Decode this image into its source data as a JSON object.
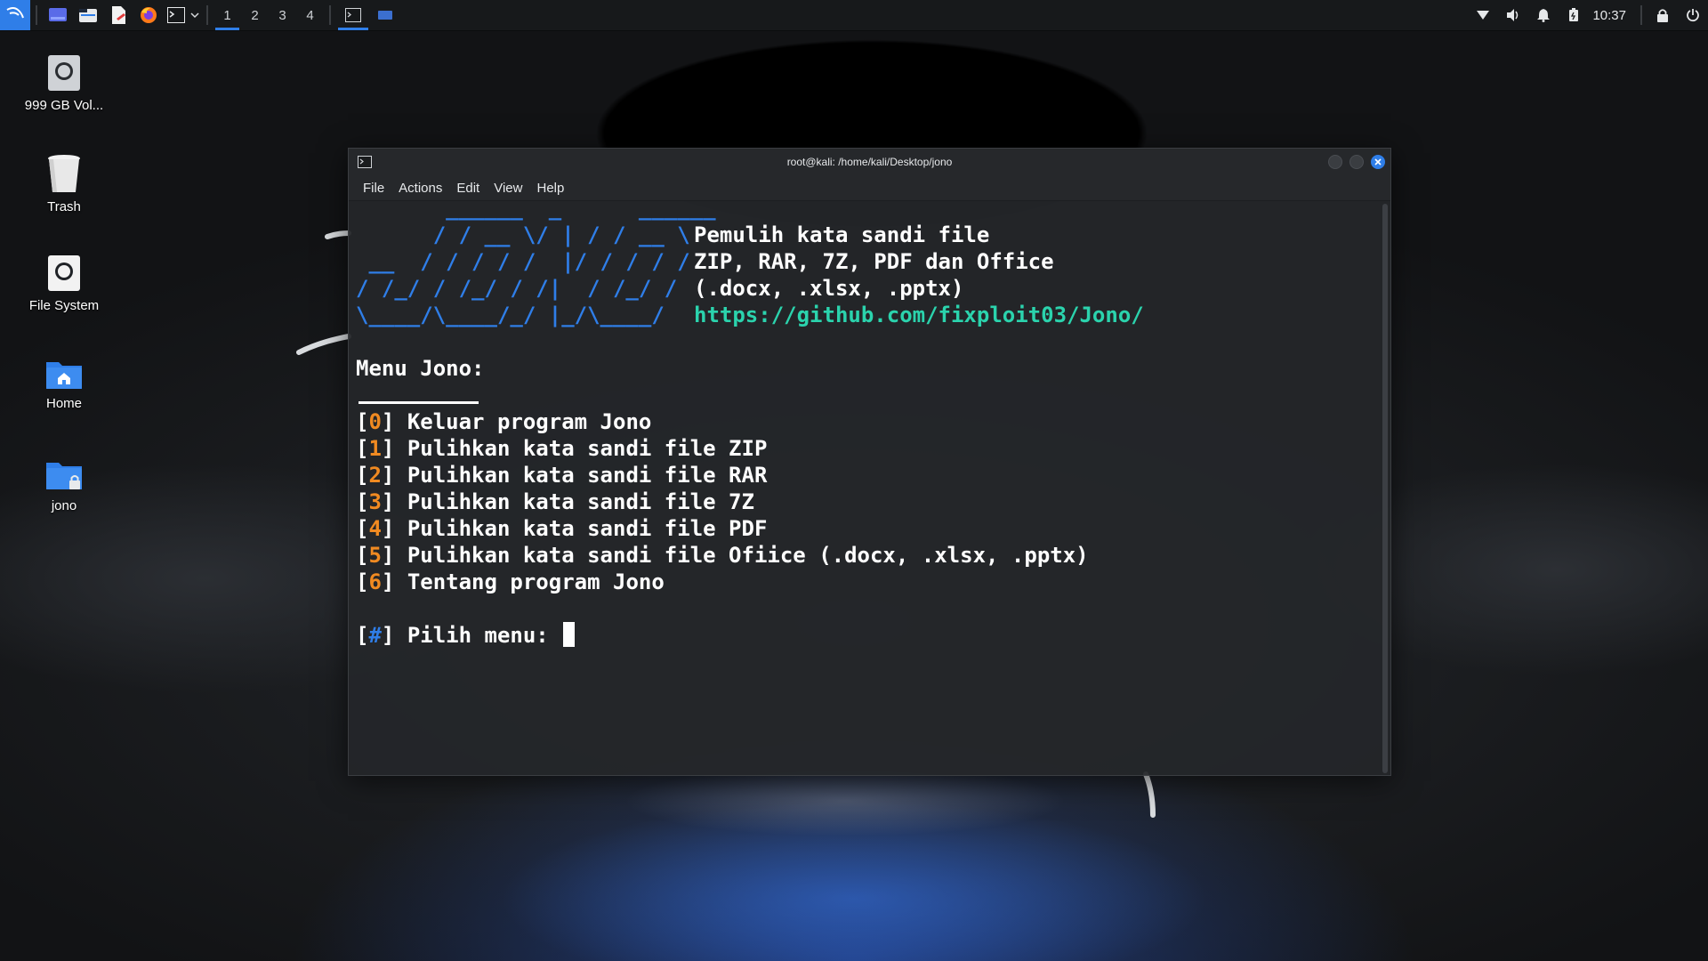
{
  "taskbar": {
    "workspaces": [
      "1",
      "2",
      "3",
      "4"
    ],
    "active_workspace": "1",
    "clock": "10:37",
    "accent": "#2f7ee8"
  },
  "desktop": {
    "icons": [
      {
        "label": "999 GB Vol...",
        "icon": "drive-icon"
      },
      {
        "label": "Trash",
        "icon": "trash-icon"
      },
      {
        "label": "File System",
        "icon": "drive-icon"
      },
      {
        "label": "Home",
        "icon": "home-folder-icon"
      },
      {
        "label": "jono",
        "icon": "locked-folder-icon"
      }
    ]
  },
  "terminal": {
    "title": "root@kali: /home/kali/Desktop/jono",
    "menu": [
      "File",
      "Actions",
      "Edit",
      "View",
      "Help"
    ],
    "banner_art": [
      "       ______  _      ______",
      "      / / __ \\/ | / / __ \\",
      " __  / / / / /  |/ / / / /",
      "/ /_/ / /_/ / /|  / /_/ /",
      "\\____/\\____/_/ |_/\\____/"
    ],
    "banner_info": [
      "Pemulih kata sandi file",
      "ZIP, RAR, 7Z, PDF dan Office",
      "(.docx, .xlsx, .pptx)"
    ],
    "banner_url": "https://github.com/fixploit03/Jono/",
    "menu_title": "Menu Jono:",
    "options": [
      {
        "num": "0",
        "text": "Keluar program Jono"
      },
      {
        "num": "1",
        "text": "Pulihkan kata sandi file ZIP"
      },
      {
        "num": "2",
        "text": "Pulihkan kata sandi file RAR"
      },
      {
        "num": "3",
        "text": "Pulihkan kata sandi file 7Z"
      },
      {
        "num": "4",
        "text": "Pulihkan kata sandi file PDF"
      },
      {
        "num": "5",
        "text": "Pulihkan kata sandi file Ofiice (.docx, .xlsx, .pptx)"
      },
      {
        "num": "6",
        "text": "Tentang program Jono"
      }
    ],
    "prompt_symbol": "#",
    "prompt_text": "Pilih menu:",
    "colors": {
      "art": "#2f7ee8",
      "number": "#f08a21",
      "url": "#2bd3ad"
    }
  }
}
